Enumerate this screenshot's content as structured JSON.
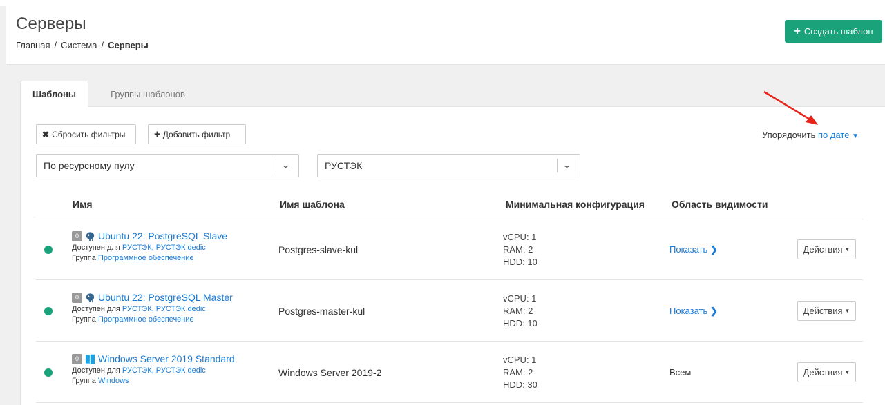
{
  "header": {
    "title": "Серверы",
    "breadcrumb": [
      "Главная",
      "Система",
      "Серверы"
    ],
    "create_button": "Создать шаблон"
  },
  "tabs": [
    {
      "label": "Шаблоны",
      "active": true
    },
    {
      "label": "Группы шаблонов",
      "active": false
    }
  ],
  "filters": {
    "reset_label": "Сбросить фильтры",
    "add_label": "Добавить фильтр",
    "sort_prefix": "Упорядочить",
    "sort_value": "по дате",
    "select_pool": "По ресурсному пулу",
    "select_value": "РУСТЭК"
  },
  "table": {
    "columns": [
      "Имя",
      "Имя шаблона",
      "Минимальная конфигурация",
      "Область видимости"
    ],
    "rows": [
      {
        "count": "0",
        "os_icon": "postgresql-elephant-icon",
        "name": "Ubuntu 22: PostgreSQL Slave",
        "available_prefix": "Доступен для",
        "available": "РУСТЭК, РУСТЭК dedic",
        "group_prefix": "Группа",
        "group": "Программное обеспечение",
        "template": "Postgres-slave-kul",
        "vcpu": "vCPU: 1",
        "ram": "RAM: 2",
        "hdd": "HDD: 10",
        "visibility": "Показать",
        "visibility_is_link": true,
        "actions": "Действия"
      },
      {
        "count": "0",
        "os_icon": "postgresql-elephant-icon",
        "name": "Ubuntu 22: PostgreSQL Master",
        "available_prefix": "Доступен для",
        "available": "РУСТЭК, РУСТЭК dedic",
        "group_prefix": "Группа",
        "group": "Программное обеспечение",
        "template": "Postgres-master-kul",
        "vcpu": "vCPU: 1",
        "ram": "RAM: 2",
        "hdd": "HDD: 10",
        "visibility": "Показать",
        "visibility_is_link": true,
        "actions": "Действия"
      },
      {
        "count": "0",
        "os_icon": "windows-icon",
        "name": "Windows Server 2019 Standard",
        "available_prefix": "Доступен для",
        "available": "РУСТЭК, РУСТЭК dedic",
        "group_prefix": "Группа",
        "group": "Windows",
        "template": "Windows Server 2019-2",
        "vcpu": "vCPU: 1",
        "ram": "RAM: 2",
        "hdd": "HDD: 30",
        "visibility": "Всем",
        "visibility_is_link": false,
        "actions": "Действия"
      }
    ]
  },
  "colors": {
    "accent_green": "#1aa37b",
    "link_blue": "#1a7bd6",
    "annotation_red": "#e8231a"
  }
}
